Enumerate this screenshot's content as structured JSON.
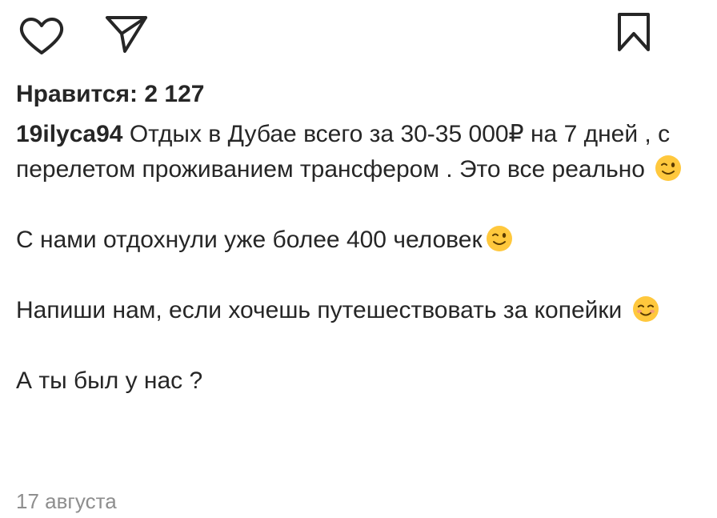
{
  "post": {
    "likes_text": "Нравится: 2 127",
    "username": "19ilyca94",
    "caption_lines": [
      "Отдых в Дубае всего за 30-35 000₽ на 7 дней , с перелетом проживанием трансфером . Это все реально",
      "С нами отдохнули уже более 400 человек",
      "Напиши нам, если хочешь путешествовать за копейки",
      "А ты был у  нас ?"
    ],
    "date": "17 августа"
  },
  "icons": {
    "like": "heart-outline-icon",
    "share": "paper-plane-icon",
    "save": "bookmark-outline-icon",
    "emoji_wink": "winking-face-emoji",
    "emoji_smile": "smiling-face-emoji"
  },
  "colors": {
    "text": "#262626",
    "muted": "#8e8e8e",
    "emoji_face": "#FFC83D"
  }
}
